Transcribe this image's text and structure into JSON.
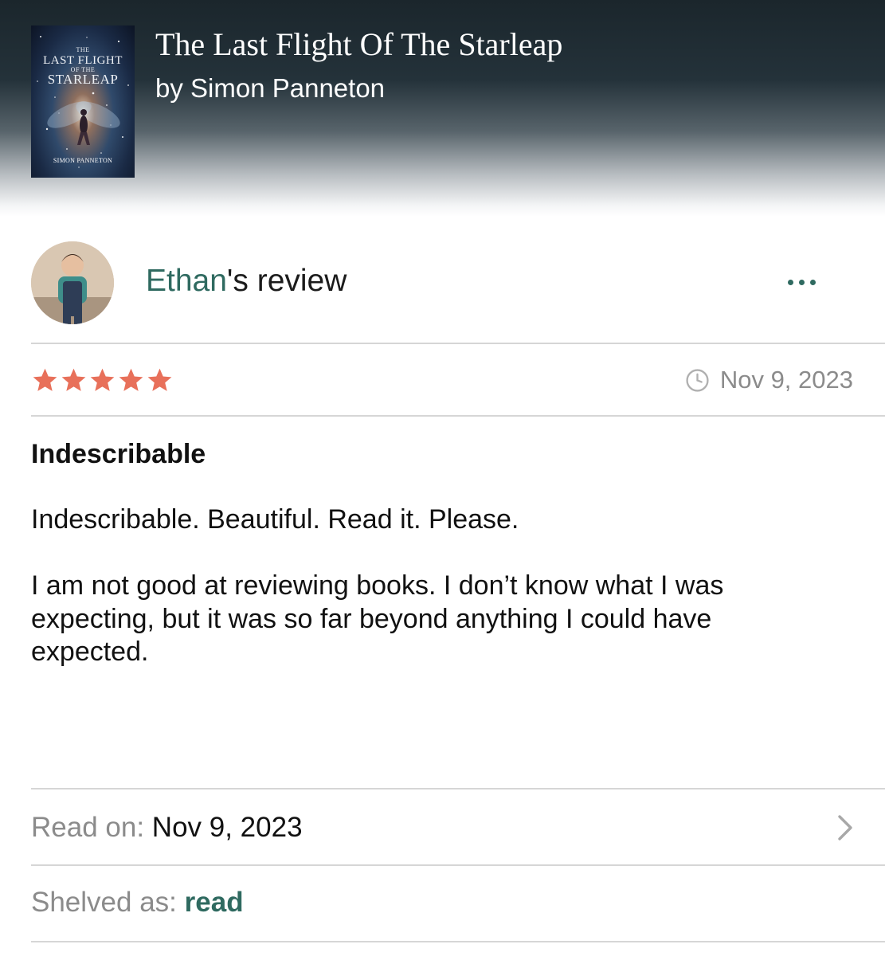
{
  "book": {
    "title": "The Last Flight Of The Starleap",
    "author_line": "by Simon Panneton",
    "cover": {
      "title_small_1": "THE",
      "title_main_1": "LAST FLIGHT",
      "title_small_2": "OF THE",
      "title_main_2": "STARLEAP",
      "author": "SIMON PANNETON"
    }
  },
  "review": {
    "reviewer_name": "Ethan",
    "reviewer_suffix": "'s review",
    "rating": 5,
    "rating_max": 5,
    "date": "Nov 9, 2023",
    "heading": "Indescribable",
    "paragraphs": [
      "Indescribable. Beautiful. Read it. Please.",
      "I am not good at reviewing books. I don’t know what I was expecting, but it was so far beyond anything I could have expected."
    ]
  },
  "details": {
    "read_on_label": "Read on:",
    "read_on_value": "Nov 9, 2023",
    "shelved_label": "Shelved as:",
    "shelved_value": "read"
  },
  "icons": {
    "more": "more-horizontal-icon",
    "clock": "clock-icon",
    "star": "star-icon",
    "chevron": "chevron-right-icon"
  },
  "colors": {
    "accent_green": "#2f6a60",
    "star": "#e8705a",
    "muted_text": "#8b8b8b"
  }
}
